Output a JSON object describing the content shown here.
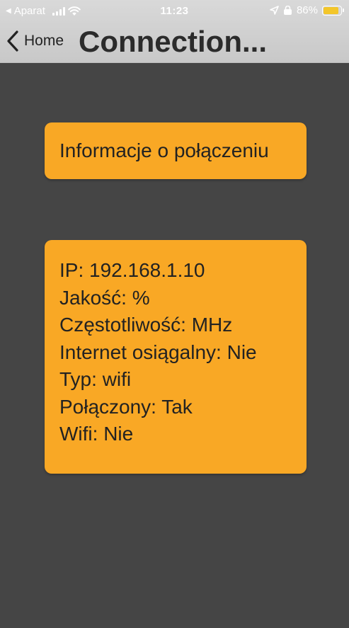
{
  "status_bar": {
    "back_app": "Aparat",
    "time": "11:23",
    "battery": "86%",
    "battery_level": 0.86,
    "signal_bars": 4,
    "icons": [
      "back-triangle-icon",
      "signal-icon",
      "wifi-icon",
      "location-arrow-icon",
      "orientation-lock-icon",
      "battery-charging-icon"
    ]
  },
  "nav": {
    "back_label": "Home",
    "title": "Connection..."
  },
  "info_button": {
    "label": "Informacje o połączeniu"
  },
  "details": {
    "lines": [
      "IP: 192.168.1.10",
      "Jakość: %",
      "Częstotliwość: MHz",
      "Internet osiągalny: Nie",
      "Typ: wifi",
      "Połączony: Tak",
      "Wifi: Nie"
    ]
  },
  "colors": {
    "background": "#454545",
    "header": "#d4d4d4",
    "card": "#f9a825",
    "text": "#222222"
  }
}
